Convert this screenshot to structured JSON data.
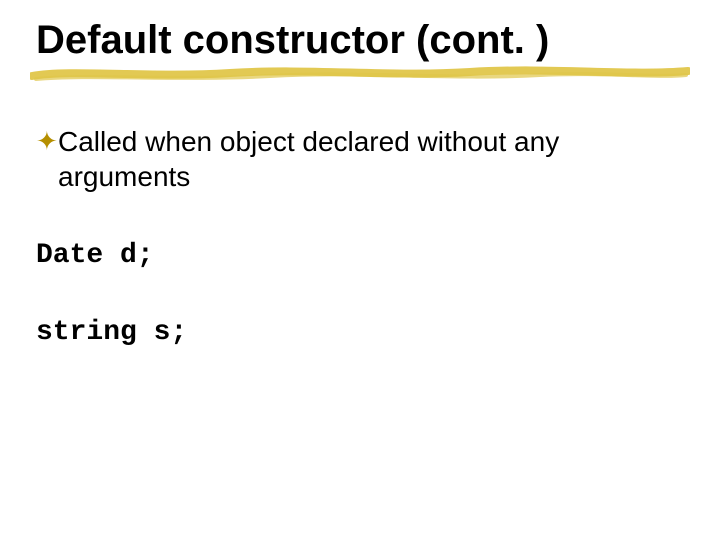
{
  "title": "Default constructor (cont. )",
  "bullet": {
    "icon_name": "decorative-bullet-icon",
    "text": "Called when object declared without any arguments"
  },
  "code": {
    "line1": "Date d;",
    "line2": "string s;"
  },
  "colors": {
    "accent": "#e0c64a",
    "bullet": "#b58f00"
  }
}
